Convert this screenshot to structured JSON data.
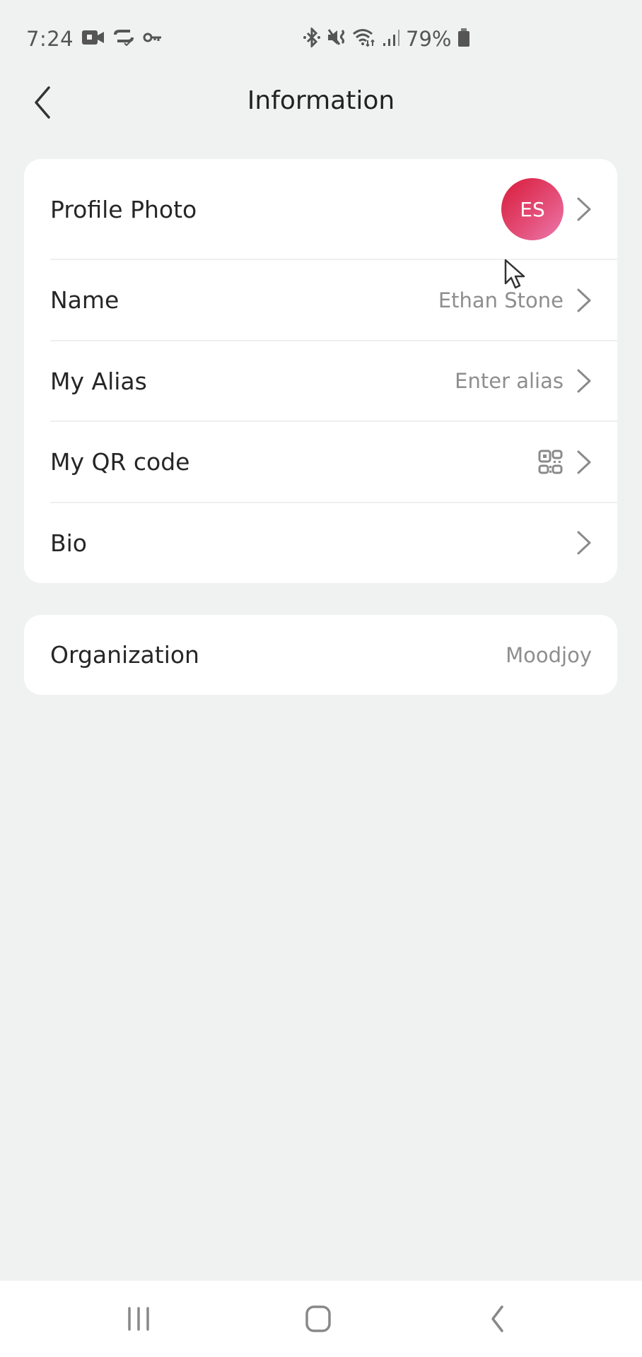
{
  "status_bar": {
    "time": "7:24",
    "left_icons": [
      "video-camera-icon",
      "sync-check-icon",
      "vpn-key-icon"
    ],
    "right_icons": [
      "bluetooth-icon",
      "mute-vibrate-icon",
      "wifi-data-icon",
      "signal-icon"
    ],
    "battery_percent": "79%"
  },
  "header": {
    "title": "Information",
    "back_icon": "chevron-left-icon"
  },
  "profile_card": {
    "rows": [
      {
        "label": "Profile Photo",
        "avatar_initials": "ES",
        "avatar_colors": [
          "#d81b3b",
          "#ec7ab0"
        ]
      },
      {
        "label": "Name",
        "value": "Ethan Stone"
      },
      {
        "label": "My Alias",
        "value": "Enter alias"
      },
      {
        "label": "My QR code",
        "icon": "qr-code-icon"
      },
      {
        "label": "Bio",
        "value": ""
      }
    ]
  },
  "organization_card": {
    "label": "Organization",
    "value": "Moodjoy"
  },
  "nav_bar": {
    "items": [
      "recent-apps-icon",
      "home-icon",
      "back-icon"
    ]
  },
  "colors": {
    "background": "#eff2f1",
    "card": "#ffffff",
    "secondary_text": "#8e8e8e",
    "chevron": "#8a8a8a"
  }
}
